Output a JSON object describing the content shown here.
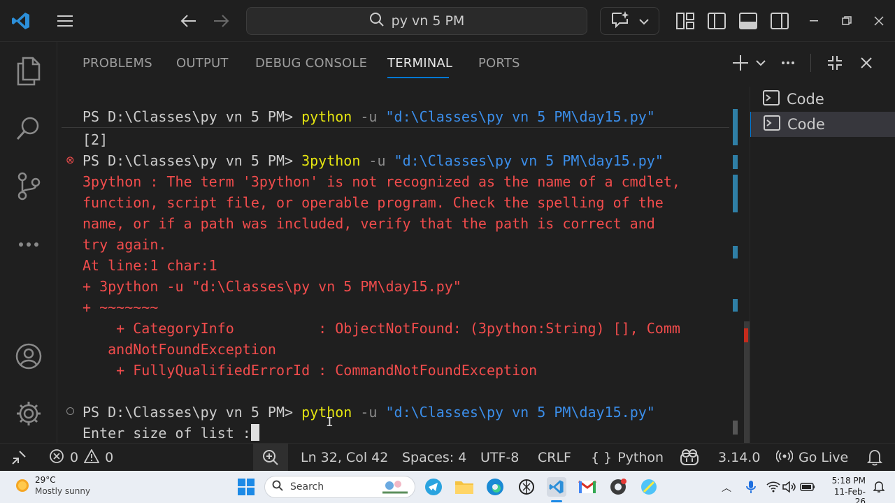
{
  "titlebar": {
    "search_text": "py vn 5 PM"
  },
  "panel": {
    "tabs": [
      "PROBLEMS",
      "OUTPUT",
      "DEBUG CONSOLE",
      "TERMINAL",
      "PORTS"
    ],
    "active_tab": "TERMINAL"
  },
  "terminal": {
    "prompt": "PS D:\\Classes\\py vn 5 PM> ",
    "line1_cmd": "python",
    "line1_flag": " -u ",
    "line1_path": "\"d:\\Classes\\py vn 5 PM\\day15.py\"",
    "line2_output": "[2]",
    "line3_cmd": "3python",
    "line3_flag": " -u ",
    "line3_path": "\"d:\\Classes\\py vn 5 PM\\day15.py\"",
    "error_lines": [
      "3python : The term '3python' is not recognized as the name of a cmdlet,",
      "function, script file, or operable program. Check the spelling of the",
      "name, or if a path was included, verify that the path is correct and",
      "try again.",
      "At line:1 char:1",
      "+ 3python -u \"d:\\Classes\\py vn 5 PM\\day15.py\"",
      "+ ~~~~~~~",
      "    + CategoryInfo          : ObjectNotFound: (3python:String) [], Comm",
      "   andNotFoundException",
      "    + FullyQualifiedErrorId : CommandNotFoundException"
    ],
    "line4_cmd": "python",
    "line4_flag": " -u ",
    "line4_path": "\"d:\\Classes\\py vn 5 PM\\day15.py\"",
    "input_prompt": "Enter size of list :"
  },
  "terminal_list": [
    {
      "label": "Code",
      "active": false
    },
    {
      "label": "Code",
      "active": true
    }
  ],
  "statusbar": {
    "errors": "0",
    "warnings": "0",
    "position": "Ln 32, Col 42",
    "spaces": "Spaces: 4",
    "encoding": "UTF-8",
    "eol": "CRLF",
    "language": "Python",
    "python_version": "3.14.0",
    "go_live": "Go Live"
  },
  "taskbar": {
    "weather_temp": "29°C",
    "weather_desc": "Mostly sunny",
    "search_placeholder": "Search",
    "time": "5:18 PM",
    "date": "11-Feb-26"
  },
  "colors": {
    "accent": "#0078d4",
    "error_red": "#f14c4c",
    "command_yellow": "#e5e510",
    "string_blue": "#3b8eea"
  }
}
